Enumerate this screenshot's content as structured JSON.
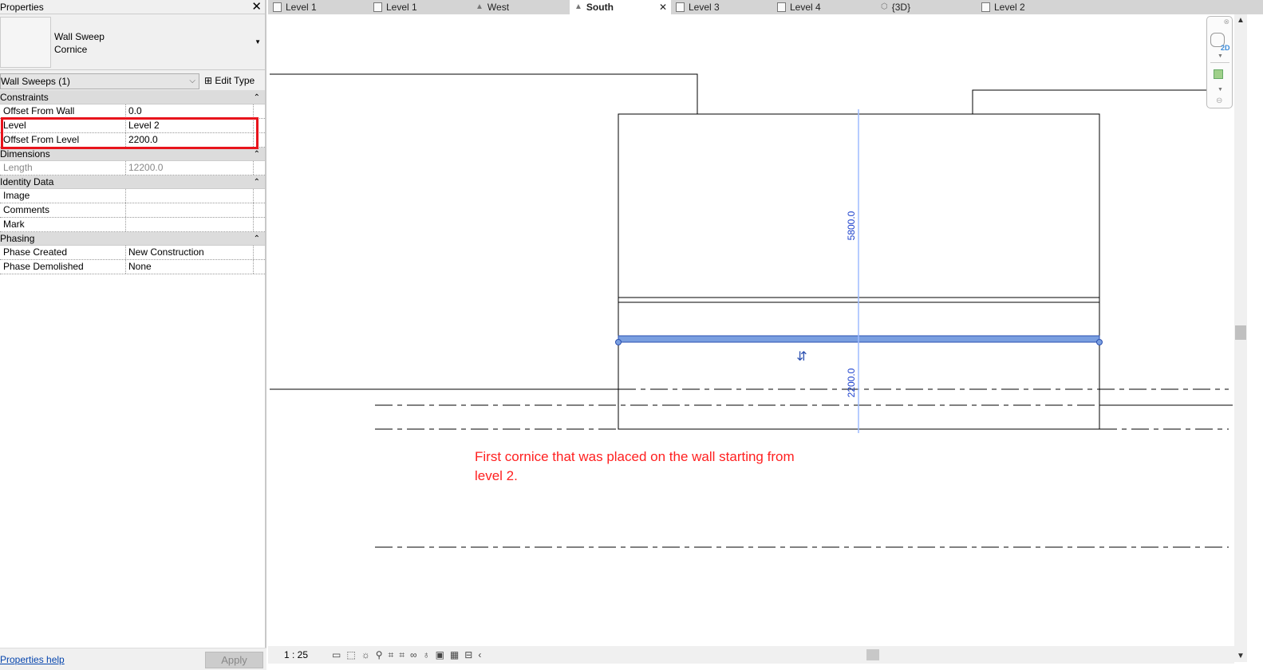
{
  "properties": {
    "title": "Properties",
    "type_family": "Wall Sweep",
    "type_name": "Cornice",
    "filter": "Wall Sweeps (1)",
    "edit_type": "Edit Type",
    "groups": [
      {
        "name": "Constraints",
        "rows": [
          {
            "k": "Offset From Wall",
            "v": "0.0"
          },
          {
            "k": "Level",
            "v": "Level 2"
          },
          {
            "k": "Offset From Level",
            "v": "2200.0"
          }
        ]
      },
      {
        "name": "Dimensions",
        "rows": [
          {
            "k": "Length",
            "v": "12200.0"
          }
        ]
      },
      {
        "name": "Identity Data",
        "rows": [
          {
            "k": "Image",
            "v": ""
          },
          {
            "k": "Comments",
            "v": ""
          },
          {
            "k": "Mark",
            "v": ""
          }
        ]
      },
      {
        "name": "Phasing",
        "rows": [
          {
            "k": "Phase Created",
            "v": "New Construction"
          },
          {
            "k": "Phase Demolished",
            "v": "None"
          }
        ]
      }
    ],
    "help": "Properties help",
    "apply": "Apply"
  },
  "tabs": [
    {
      "label": "Level 1",
      "icon": "plan"
    },
    {
      "label": "Level 1",
      "icon": "plan"
    },
    {
      "label": "West",
      "icon": "elevation"
    },
    {
      "label": "South",
      "icon": "elevation",
      "active": true
    },
    {
      "label": "Level 3",
      "icon": "plan"
    },
    {
      "label": "Level 4",
      "icon": "plan"
    },
    {
      "label": "{3D}",
      "icon": "3d"
    },
    {
      "label": "Level 2",
      "icon": "plan"
    }
  ],
  "view": {
    "dim_upper": "5800.0",
    "dim_lower": "2200.0",
    "annotation_line1": "First cornice that was placed on the wall starting from",
    "annotation_line2": "level 2.",
    "annotation_color": "#ff2020",
    "selection_color": "#7a9fe0"
  },
  "status": {
    "scale": "1 : 25"
  },
  "navbar": {
    "label_2d": "2D"
  }
}
